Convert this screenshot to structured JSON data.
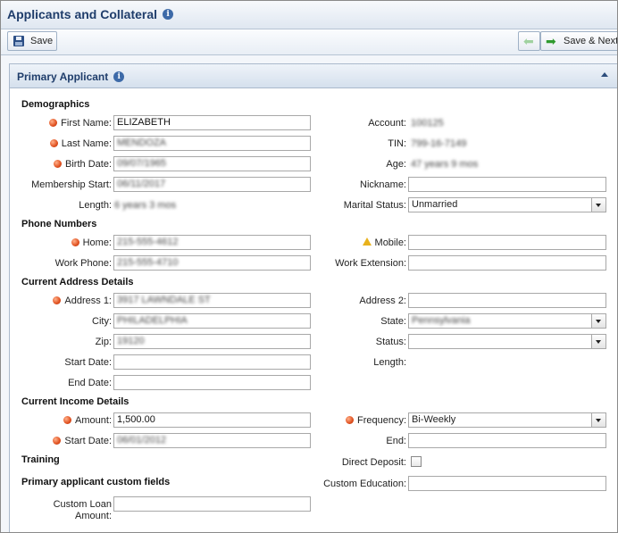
{
  "window": {
    "title": "Applicants and Collateral"
  },
  "toolbar": {
    "save_label": "Save",
    "save_next_label": "Save & Next"
  },
  "panel": {
    "title": "Primary Applicant"
  },
  "sections": {
    "demographics": "Demographics",
    "phone": "Phone Numbers",
    "address": "Current Address Details",
    "income": "Current Income Details",
    "training": "Training",
    "custom": "Primary applicant custom fields"
  },
  "demographics": {
    "first_name_label": "First Name:",
    "first_name": "ELIZABETH",
    "last_name_label": "Last Name:",
    "last_name": "MENDOZA",
    "birth_date_label": "Birth Date:",
    "birth_date": "09/07/1965",
    "membership_start_label": "Membership Start:",
    "membership_start": "06/11/2017",
    "length_label": "Length:",
    "length": "6 years 3 mos",
    "account_label": "Account:",
    "account": "100125",
    "tin_label": "TIN:",
    "tin": "799-16-7149",
    "age_label": "Age:",
    "age": "47 years 9 mos",
    "nickname_label": "Nickname:",
    "nickname": "",
    "marital_label": "Marital Status:",
    "marital": "Unmarried"
  },
  "phone": {
    "home_label": "Home:",
    "home": "215-555-4612",
    "work_label": "Work Phone:",
    "work": "215-555-4710",
    "mobile_label": "Mobile:",
    "mobile": "",
    "ext_label": "Work Extension:",
    "ext": ""
  },
  "address": {
    "address1_label": "Address 1:",
    "address1": "3917 LAWNDALE ST",
    "city_label": "City:",
    "city": "PHILADELPHIA",
    "zip_label": "Zip:",
    "zip": "19120",
    "start_label": "Start Date:",
    "start": "",
    "end_label": "End Date:",
    "end": "",
    "address2_label": "Address 2:",
    "address2": "",
    "state_label": "State:",
    "state": "Pennsylvania",
    "status_label": "Status:",
    "status": "",
    "length_label": "Length:"
  },
  "income": {
    "amount_label": "Amount:",
    "amount": "1,500.00",
    "start_label": "Start Date:",
    "start": "06/01/2012",
    "frequency_label": "Frequency:",
    "frequency": "Bi-Weekly",
    "end_label": "End:",
    "end": ""
  },
  "training": {
    "direct_deposit_label": "Direct Deposit:"
  },
  "custom": {
    "loan_amount_label_1": "Custom Loan",
    "loan_amount_label_2": "Amount:",
    "loan_amount": "",
    "education_label": "Custom Education:",
    "education": ""
  },
  "colors": {
    "title": "#1f3d6b",
    "required": "#e0501f",
    "warning": "#e8b21c",
    "accent": "#3d6aa8"
  }
}
